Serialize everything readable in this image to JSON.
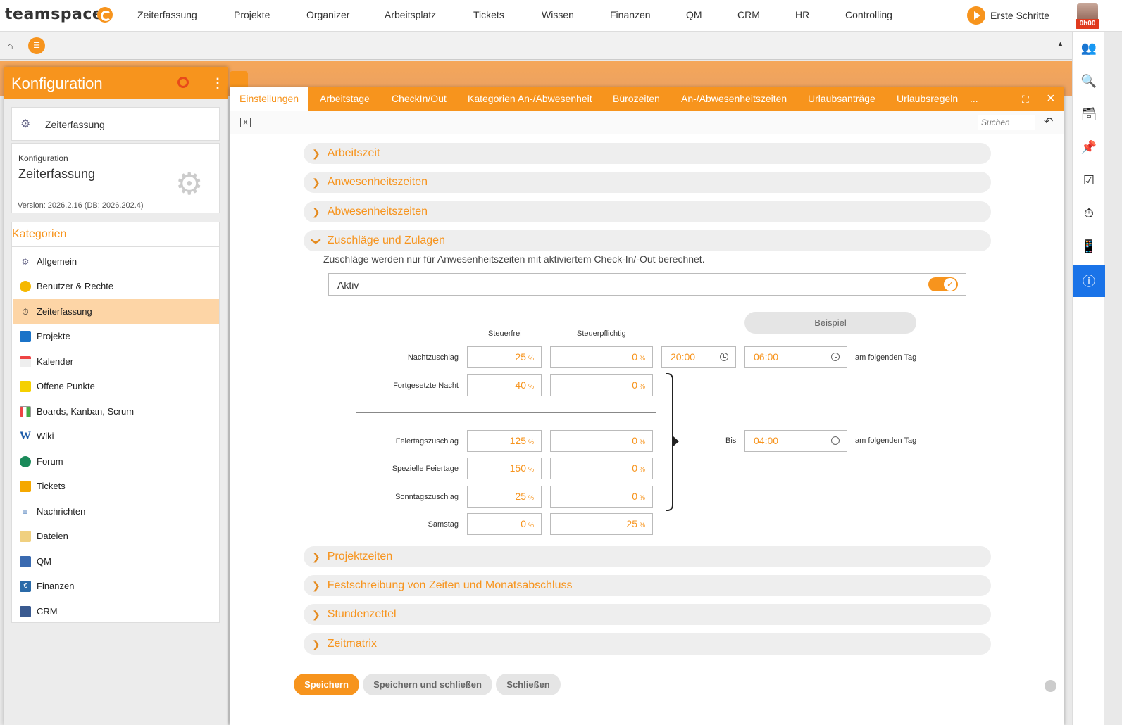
{
  "topnav": {
    "logo": "teamspace",
    "items": [
      "Zeiterfassung",
      "Projekte",
      "Organizer",
      "Arbeitsplatz",
      "Tickets",
      "Wissen",
      "Finanzen",
      "QM",
      "CRM",
      "HR",
      "Controlling"
    ],
    "erste_schritte": "Erste Schritte",
    "time_badge": "0h00"
  },
  "config": {
    "title": "Konfiguration",
    "module": "Zeiterfassung",
    "info_label": "Konfiguration",
    "info_title": "Zeiterfassung",
    "version": "Version: 2026.2.16 (DB: 2026.202.4)",
    "kategorien_title": "Kategorien",
    "categories": [
      "Allgemein",
      "Benutzer & Rechte",
      "Zeiterfassung",
      "Projekte",
      "Kalender",
      "Offene Punkte",
      "Boards, Kanban, Scrum",
      "Wiki",
      "Forum",
      "Tickets",
      "Nachrichten",
      "Dateien",
      "QM",
      "Finanzen",
      "CRM"
    ],
    "selected_category": "Zeiterfassung"
  },
  "tabs": [
    "Einstellungen",
    "Arbeitstage",
    "CheckIn/Out",
    "Kategorien An-/Abwesenheit",
    "Bürozeiten",
    "An-/Abwesenheitszeiten",
    "Urlaubsanträge",
    "Urlaubsregeln",
    "..."
  ],
  "search": {
    "placeholder": "Suchen"
  },
  "sections_top": [
    "Arbeitszeit",
    "Anwesenheitszeiten",
    "Abwesenheitszeiten"
  ],
  "section_open": "Zuschläge und Zulagen",
  "zuschlag_info": "Zuschläge werden nur für Anwesenheitszeiten mit aktiviertem Check-In/-Out berechnet.",
  "aktiv": {
    "label": "Aktiv",
    "on": true
  },
  "beispiel": "Beispiel",
  "columns": {
    "steuerfrei": "Steuerfrei",
    "steuerpflichtig": "Steuerpflichtig"
  },
  "rows": [
    {
      "label": "Nachtzuschlag",
      "steuerfrei": "25",
      "steuerpflichtig": "0"
    },
    {
      "label": "Fortgesetzte Nacht",
      "steuerfrei": "40",
      "steuerpflichtig": "0"
    },
    {
      "label": "Feiertagszuschlag",
      "steuerfrei": "125",
      "steuerpflichtig": "0"
    },
    {
      "label": "Spezielle Feiertage",
      "steuerfrei": "150",
      "steuerpflichtig": "0"
    },
    {
      "label": "Sonntagszuschlag",
      "steuerfrei": "25",
      "steuerpflichtig": "0"
    },
    {
      "label": "Samstag",
      "steuerfrei": "0",
      "steuerpflichtig": "25"
    }
  ],
  "percent_sign": "%",
  "night": {
    "from": "20:00",
    "to": "06:00",
    "next_day": "am folgenden Tag"
  },
  "bis": {
    "label": "Bis",
    "time": "04:00",
    "next_day": "am folgenden Tag"
  },
  "sections_bottom": [
    "Projektzeiten",
    "Festschreibung von Zeiten und Monatsabschluss",
    "Stundenzettel",
    "Zeitmatrix"
  ],
  "buttons": {
    "save": "Speichern",
    "save_close": "Speichern und schließen",
    "close": "Schließen"
  },
  "colors": {
    "accent": "#f7941d",
    "selected_row": "#fdd5a6",
    "info_active": "#1a73e8"
  }
}
